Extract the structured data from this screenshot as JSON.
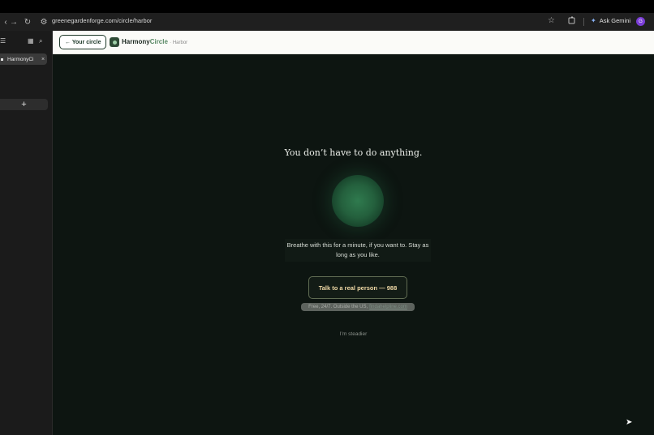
{
  "browser": {
    "address": "greenegardenforge.com/circle/harbor",
    "ask_gemini": "Ask Gemini",
    "profile_initial": "G"
  },
  "sidebar": {
    "tab_label": "HarmonyCi",
    "tab_close": "×",
    "new_tab": "+"
  },
  "header": {
    "back_label": "← Your circle",
    "brand_part1": "Harmony",
    "brand_part2": "Circle",
    "brand_sub": "· Harbor"
  },
  "main": {
    "headline": "You don’t have to do anything.",
    "breathe_text": "Breathe with this for a minute, if you want to. Stay as long as you like.",
    "talk_button": "Talk to a real person — 988",
    "free_note": "Free, 24/7. Outside the US,",
    "free_note_link": "findahelpline.com",
    "steadier": "I’m steadier"
  },
  "colors": {
    "accent_green": "#2f7a4e",
    "background": "#0d1511",
    "talk_text": "#f0d9a6"
  },
  "icons": [
    "back-icon",
    "forward-icon",
    "reload-icon",
    "site-settings-icon",
    "star-icon",
    "extensions-icon",
    "gemini-icon",
    "tab-grid-icon",
    "tab-search-icon",
    "cursor-icon"
  ]
}
